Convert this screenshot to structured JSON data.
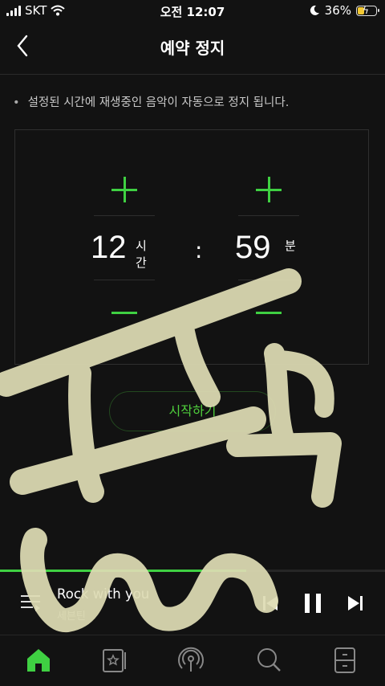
{
  "status_bar": {
    "carrier": "SKT",
    "time": "오전 12:07",
    "battery": "36%",
    "battery_level": 0.36
  },
  "header": {
    "title": "예약 정지"
  },
  "notice": {
    "bullet": "•",
    "text": "설정된 시간에 재생중인 음악이 자동으로 정지 됩니다."
  },
  "timer": {
    "hours": {
      "value": "12",
      "unit": "시간"
    },
    "separator": ":",
    "minutes": {
      "value": "59",
      "unit": "분"
    }
  },
  "start_button": {
    "label": "시작하기"
  },
  "player": {
    "progress": 0.64,
    "title": "Rock with you",
    "artist": "세븐틴"
  },
  "nav": {
    "items": [
      "home-icon",
      "library-icon",
      "podcast-icon",
      "search-icon",
      "storage-icon"
    ],
    "active": "home"
  },
  "colors": {
    "accent": "#3fd042",
    "background": "#121212",
    "overlay": "#dedcb4"
  }
}
